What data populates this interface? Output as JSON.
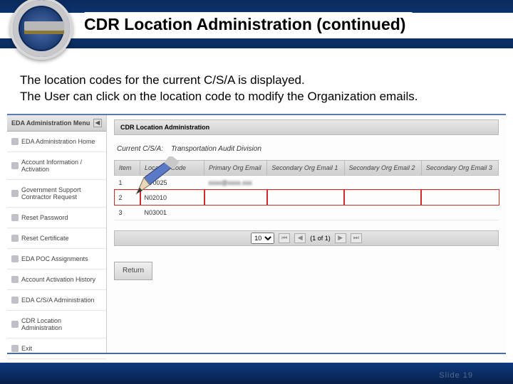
{
  "slide": {
    "title": "CDR Location Administration (continued)",
    "desc_line1": "The location codes for the current C/S/A is displayed.",
    "desc_line2": "The User can click on the location code to modify the Organization emails.",
    "slide_number": "Slide 19"
  },
  "sidebar": {
    "header": "EDA Administration Menu",
    "items": [
      {
        "label": "EDA Administration Home"
      },
      {
        "label": "Account Information / Activation"
      },
      {
        "label": "Government Support Contractor Request"
      },
      {
        "label": "Reset Password"
      },
      {
        "label": "Reset Certificate"
      },
      {
        "label": "EDA POC Assignments"
      },
      {
        "label": "Account Activation History"
      },
      {
        "label": "EDA C/S/A Administration"
      },
      {
        "label": "CDR Location Administration"
      },
      {
        "label": "Exit"
      }
    ]
  },
  "main": {
    "tab_label": "CDR Location Administration",
    "csia_label": "Current C/S/A:",
    "csia_value": "Transportation Audit Division",
    "columns": {
      "item": "Item",
      "location": "Location Code",
      "primary": "Primary Org Email",
      "sec1": "Secondary Org Email 1",
      "sec2": "Secondary Org Email 2",
      "sec3": "Secondary Org Email 3"
    },
    "rows": [
      {
        "item": "1",
        "location": "HT0025",
        "primary_blur": "xxxx@xxxx.xxx"
      },
      {
        "item": "2",
        "location": "N02010",
        "highlight": true
      },
      {
        "item": "3",
        "location": "N03001"
      }
    ],
    "pager": {
      "page_size": "10",
      "info": "(1 of 1)"
    },
    "return_label": "Return"
  }
}
